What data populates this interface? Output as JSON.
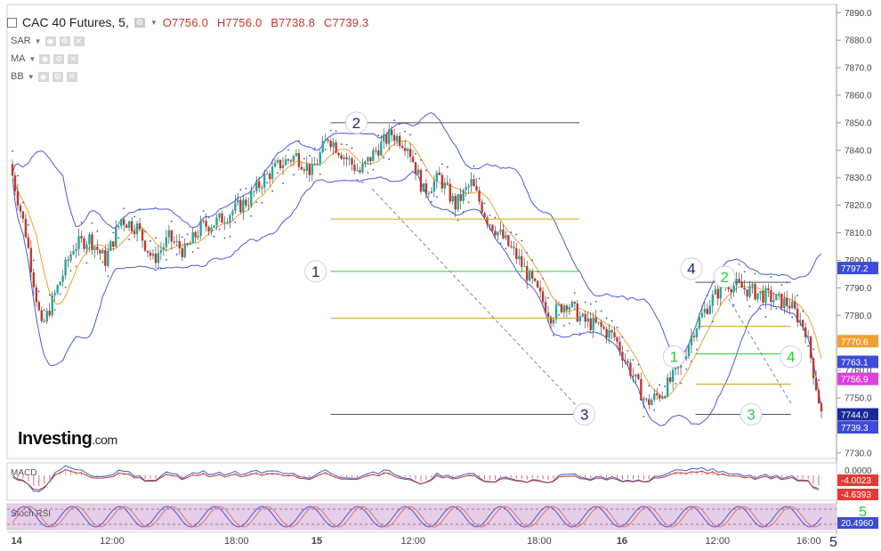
{
  "header": {
    "title": "CAC 40 Futures, 5,",
    "open": "O7756.0",
    "high": "H7756.0",
    "low": "B7738.8",
    "close": "C7739.3"
  },
  "indicators": [
    "SAR",
    "MA",
    "BB"
  ],
  "logo": {
    "main": "Investing",
    "suffix": ".com"
  },
  "colors": {
    "up_candle": "#26a69a",
    "down_candle": "#c0392b",
    "bollinger": "#4a5bd6",
    "ma": "#f0a030",
    "sar": "#3c4bd8",
    "fib_green": "#2ecc40",
    "fib_orange": "#d4a017",
    "fib_gray": "#555555",
    "stoch_fill": "#e6cde8"
  },
  "chart_data": {
    "type": "candlestick",
    "y_ticks": [
      "7890.0",
      "7880.0",
      "7870.0",
      "7860.0",
      "7850.0",
      "7840.0",
      "7830.0",
      "7820.0",
      "7810.0",
      "7800.0",
      "7790.0",
      "7780.0",
      "7770.0",
      "7760.0",
      "7750.0",
      "7740.0",
      "7730.0"
    ],
    "ylim": [
      7728,
      7893
    ],
    "x_ticks": [
      "14",
      "12:00",
      "18:00",
      "15",
      "12:00",
      "18:00",
      "16",
      "12:00",
      "16:00"
    ],
    "price_labels": [
      {
        "text": "7797.2",
        "value": 7797.2,
        "bg": "#3c4bd8"
      },
      {
        "text": "7770.6",
        "value": 7770.6,
        "bg": "#f0a030"
      },
      {
        "text": "7763.1",
        "value": 7763.1,
        "bg": "#3c4bd8"
      },
      {
        "text": "7756.9",
        "value": 7756.9,
        "bg": "#e040e0"
      },
      {
        "text": "7744.0",
        "value": 7744.0,
        "bg": "#1a2a9a"
      },
      {
        "text": "7739.3",
        "value": 7739.3,
        "bg": "#3c4bd8"
      }
    ],
    "close_path": [
      7835,
      7810,
      7775,
      7790,
      7805,
      7808,
      7800,
      7815,
      7812,
      7800,
      7808,
      7803,
      7812,
      7814,
      7818,
      7822,
      7830,
      7835,
      7838,
      7832,
      7845,
      7838,
      7832,
      7840,
      7846,
      7842,
      7825,
      7830,
      7820,
      7828,
      7815,
      7808,
      7800,
      7790,
      7780,
      7785,
      7778,
      7776,
      7772,
      7760,
      7748,
      7752,
      7760,
      7775,
      7785,
      7792,
      7790,
      7788,
      7786,
      7784,
      7775,
      7744
    ],
    "fib_levels": [
      {
        "value": 7850,
        "color": "gray",
        "x_start": 0.39,
        "x_end": 0.69
      },
      {
        "value": 7815,
        "color": "orange",
        "x_start": 0.39,
        "x_end": 0.69
      },
      {
        "value": 7796,
        "color": "green",
        "x_start": 0.39,
        "x_end": 0.69
      },
      {
        "value": 7779,
        "color": "orange",
        "x_start": 0.39,
        "x_end": 0.69
      },
      {
        "value": 7744,
        "color": "gray",
        "x_start": 0.39,
        "x_end": 0.69
      },
      {
        "value": 7792,
        "color": "gray",
        "x_start": 0.83,
        "x_end": 0.945
      },
      {
        "value": 7776,
        "color": "orange",
        "x_start": 0.83,
        "x_end": 0.945
      },
      {
        "value": 7766,
        "color": "green",
        "x_start": 0.83,
        "x_end": 0.945
      },
      {
        "value": 7755,
        "color": "orange",
        "x_start": 0.83,
        "x_end": 0.945
      },
      {
        "value": 7744,
        "color": "gray",
        "x_start": 0.83,
        "x_end": 0.945
      }
    ],
    "wave_labels": [
      {
        "text": "1",
        "value": 7796,
        "x": 0.372,
        "color": "#1a2a7a"
      },
      {
        "text": "2",
        "value": 7850,
        "x": 0.421,
        "color": "#1a2a7a"
      },
      {
        "text": "3",
        "value": 7744,
        "x": 0.696,
        "color": "#1a2a7a"
      },
      {
        "text": "4",
        "value": 7797,
        "x": 0.825,
        "color": "#1a2a7a"
      },
      {
        "text": "2",
        "value": 7794,
        "x": 0.865,
        "color": "#2ecc40"
      },
      {
        "text": "1",
        "value": 7765,
        "x": 0.804,
        "color": "#2ecc40"
      },
      {
        "text": "3",
        "value": 7744,
        "x": 0.897,
        "color": "#2ecc40"
      },
      {
        "text": "4",
        "value": 7765,
        "x": 0.945,
        "color": "#2ecc40"
      }
    ],
    "macd": {
      "label": "MACD",
      "values": [
        "-4.0023",
        "-4.6393"
      ],
      "tick": "0.0000"
    },
    "stoch_rsi": {
      "label": "Stoch RSI",
      "values": [
        "20.4960"
      ]
    },
    "sub_wave_labels": [
      {
        "text": "5",
        "color": "#2ecc40"
      },
      {
        "text": "5",
        "color": "#1a2a7a"
      }
    ]
  }
}
